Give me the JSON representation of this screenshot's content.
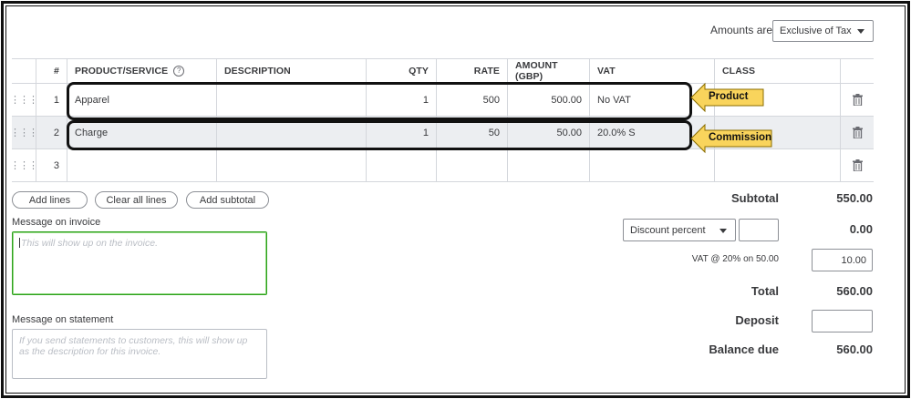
{
  "header": {
    "amounts_label": "Amounts are",
    "amounts_value": "Exclusive of Tax"
  },
  "table": {
    "columns": [
      "#",
      "PRODUCT/SERVICE",
      "DESCRIPTION",
      "QTY",
      "RATE",
      "AMOUNT (GBP)",
      "VAT",
      "CLASS"
    ],
    "rows": [
      {
        "num": "1",
        "product": "Apparel",
        "description": "",
        "qty": "1",
        "rate": "500",
        "amount": "500.00",
        "vat": "No VAT",
        "class": ""
      },
      {
        "num": "2",
        "product": "Charge",
        "description": "",
        "qty": "1",
        "rate": "50",
        "amount": "50.00",
        "vat": "20.0% S",
        "class": ""
      },
      {
        "num": "3",
        "product": "",
        "description": "",
        "qty": "",
        "rate": "",
        "amount": "",
        "vat": "",
        "class": ""
      }
    ]
  },
  "callouts": {
    "product": "Product",
    "commission": "Commission",
    "color": "#f9d45c"
  },
  "buttons": {
    "add_lines": "Add lines",
    "clear_all_lines": "Clear all lines",
    "add_subtotal": "Add subtotal"
  },
  "messages": {
    "invoice_label": "Message on invoice",
    "invoice_placeholder": "This will show up on the invoice.",
    "statement_label": "Message on statement",
    "statement_placeholder": "If you send statements to customers, this will show up as the description for this invoice."
  },
  "totals": {
    "subtotal_label": "Subtotal",
    "subtotal_value": "550.00",
    "discount_type": "Discount percent",
    "discount_input": "",
    "discount_value": "0.00",
    "vat_label": "VAT @ 20% on 50.00",
    "vat_input": "10.00",
    "total_label": "Total",
    "total_value": "560.00",
    "deposit_label": "Deposit",
    "deposit_input": "",
    "balance_label": "Balance due",
    "balance_value": "560.00"
  },
  "colors": {
    "focus_green": "#2ca01c",
    "border": "#d4d7dc"
  }
}
